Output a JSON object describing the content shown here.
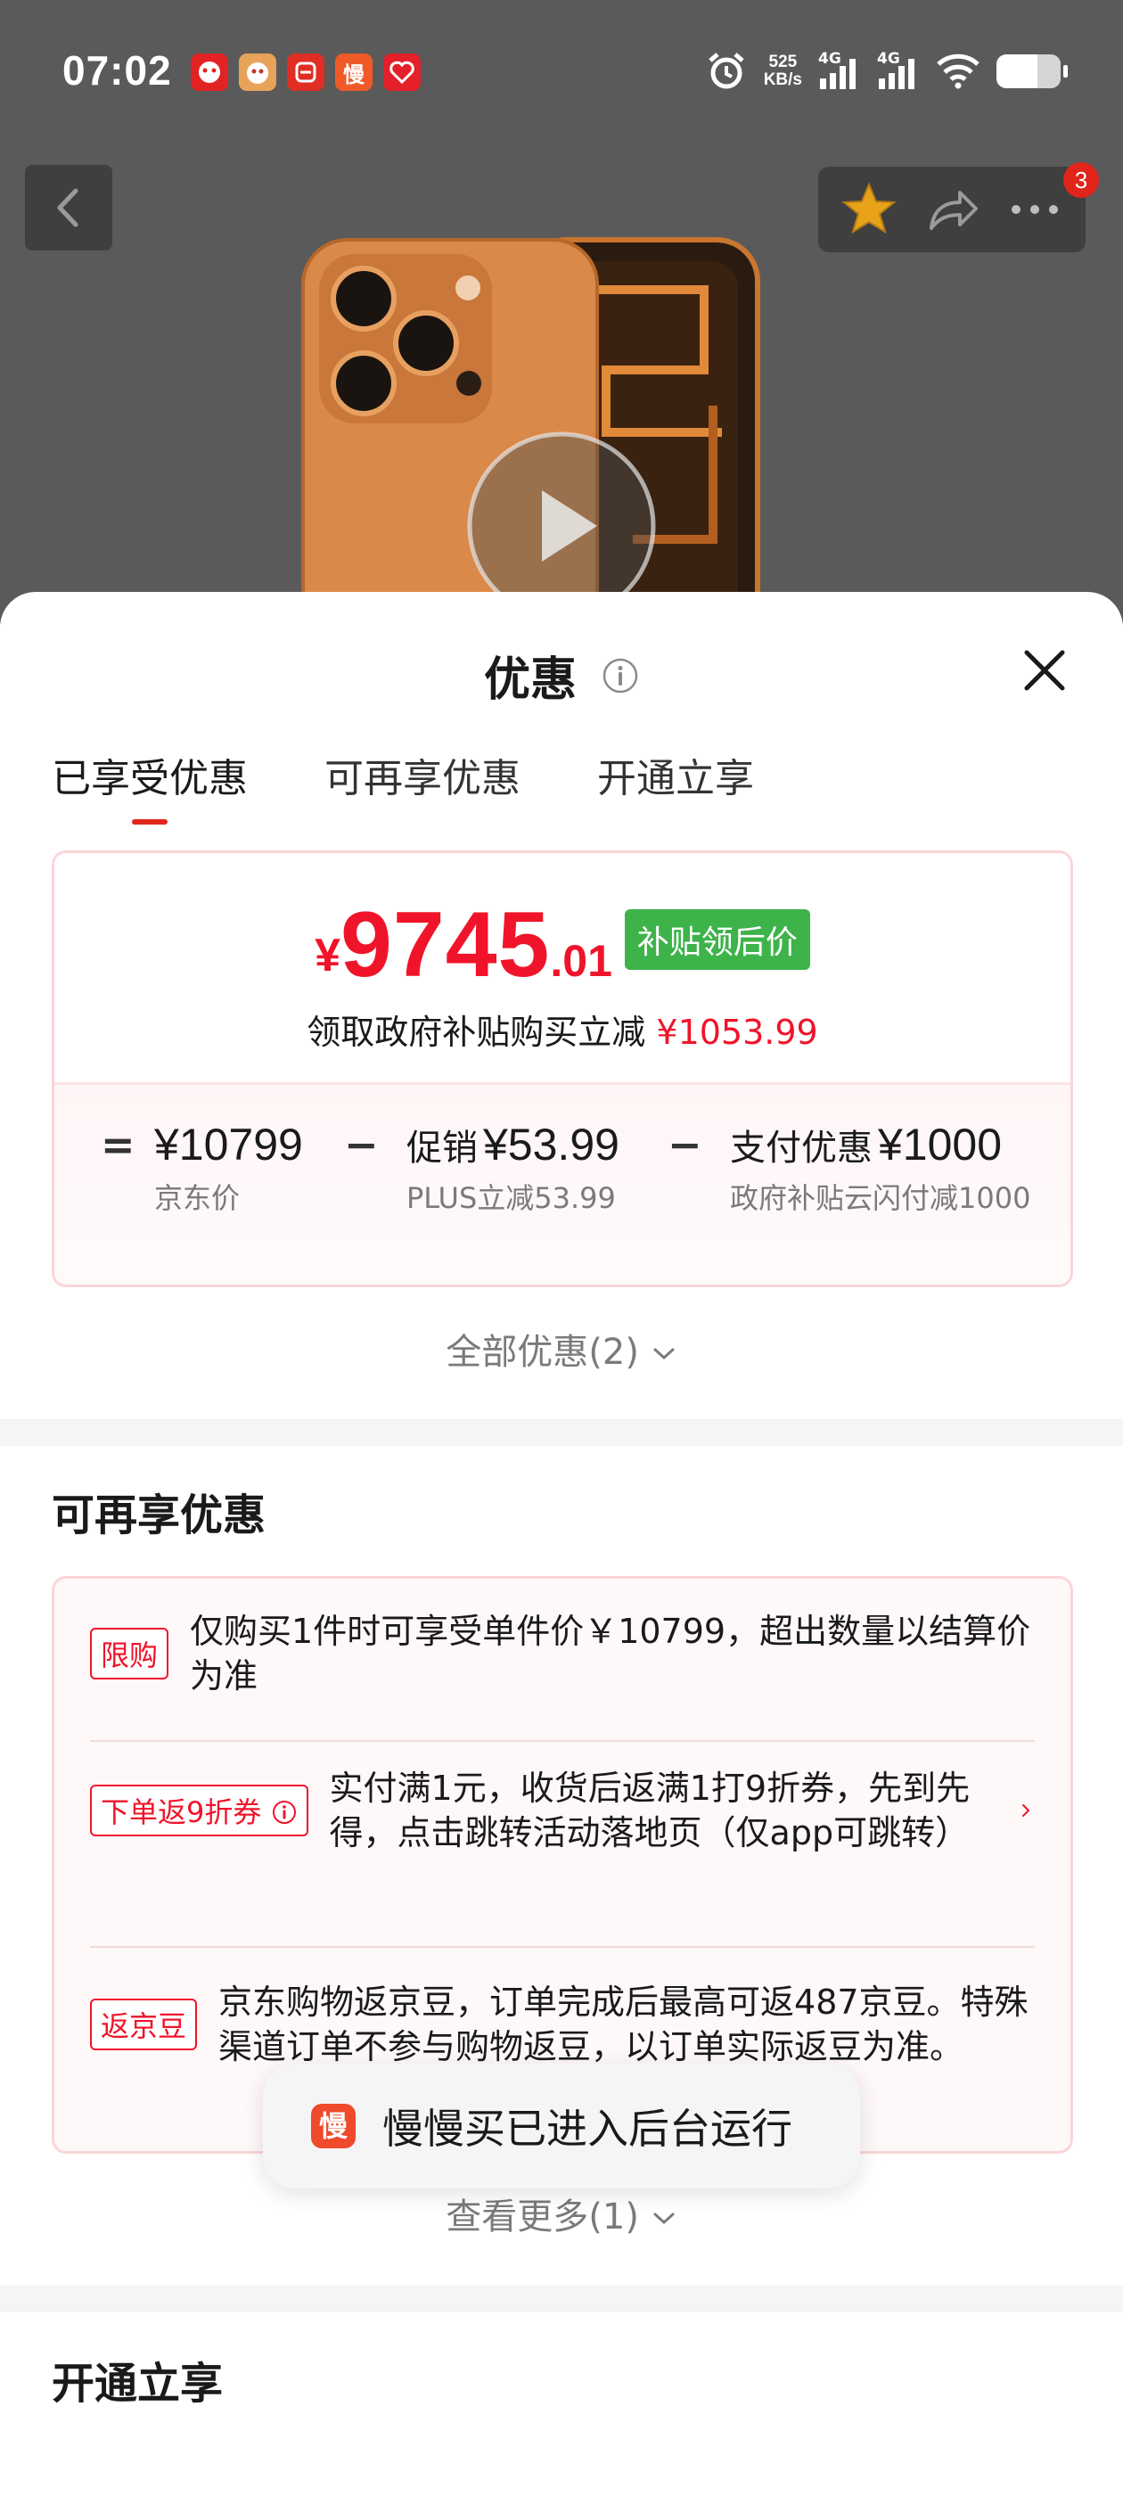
{
  "status_bar": {
    "time": "07:02",
    "net_speed": "525",
    "net_unit": "KB/s",
    "signal1": "4G",
    "signal2": "4G",
    "app_icons": [
      "jd-app-icon",
      "jd-app-icon",
      "pinduoduo-icon",
      "manmanmai-icon",
      "jd-heart-icon"
    ]
  },
  "nav": {
    "cart_badge": "3"
  },
  "sheet": {
    "title": "优惠",
    "tabs": [
      "已享受优惠",
      "可再享优惠",
      "开通立享"
    ],
    "active_tab": 0
  },
  "price_card": {
    "currency": "¥",
    "price_int": "9745",
    "price_dec": ".01",
    "tag": "补贴领后价",
    "sub_text": "领取政府补贴购买立减",
    "sub_amount": "¥1053.99",
    "equals": "=",
    "minus": "−",
    "items": [
      {
        "label": "",
        "value": "¥10799",
        "sub": "京东价"
      },
      {
        "label": "促销",
        "value": "¥53.99",
        "sub": "PLUS立减53.99"
      },
      {
        "label": "支付优惠",
        "value": "¥1000",
        "sub": "政府补贴云闪付减1000"
      }
    ]
  },
  "all_discount": "全部优惠(2)",
  "more_section": {
    "title": "可再享优惠",
    "rows": [
      {
        "chip": "限购",
        "text": "仅购买1件时可享受单件价￥10799，超出数量以结算价为准"
      },
      {
        "chip": "下单返9折券",
        "text": "实付满1元，收货后返满1打9折券，先到先得，点击跳转活动落地页（仅app可跳转）"
      },
      {
        "chip": "返京豆",
        "text": "京东购物返京豆，订单完成后最高可返487京豆。特殊渠道订单不参与购物返豆，以订单实际返豆为准。"
      }
    ],
    "see_more": "查看更多(1)"
  },
  "toast": {
    "icon_char": "慢",
    "text": "慢慢买已进入后台运行"
  },
  "open_section": {
    "title": "开通立享"
  },
  "colors": {
    "accent_red": "#f0142a",
    "tag_green": "#3db34a",
    "card_border": "#fbd5d8"
  }
}
